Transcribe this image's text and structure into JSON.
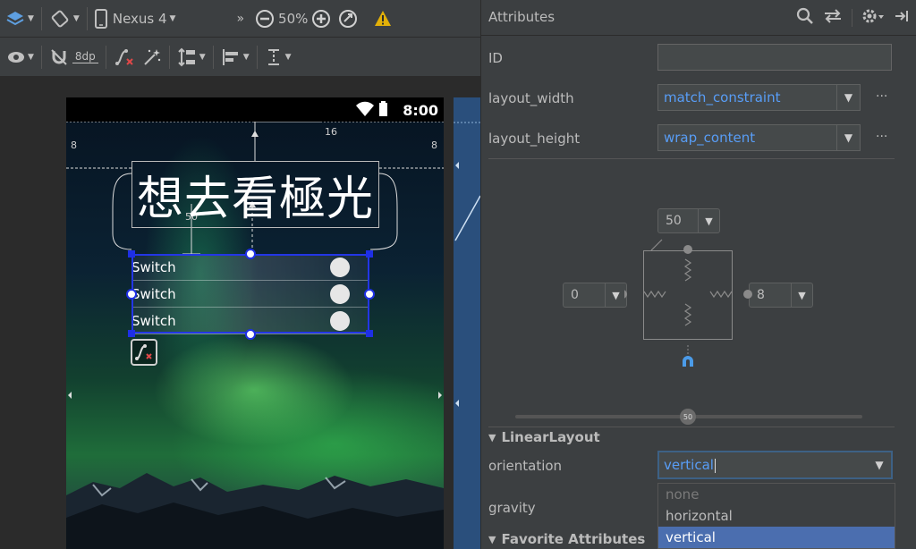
{
  "toolbar_top": {
    "device": "Nexus 4",
    "zoom": "50%",
    "more": "»",
    "icons": [
      "layers-icon",
      "rotate-icon",
      "phone-icon",
      "zoom-out-icon",
      "zoom-in-icon",
      "zoom-fit-icon",
      "warning-icon"
    ]
  },
  "toolbar_second": {
    "default_margin": "8dp",
    "icons": [
      "eye-icon",
      "magnet-off-icon",
      "clear-constraints-icon",
      "infer-constraints-icon",
      "pack-icon",
      "align-icon",
      "guideline-icon"
    ]
  },
  "phone": {
    "status_time": "8:00",
    "title": "想去看極光",
    "switches": [
      "Switch",
      "Switch",
      "Switch"
    ],
    "dimensions": {
      "top": "16",
      "left": "8",
      "right": "8",
      "gap": "50"
    }
  },
  "attributes": {
    "panel_title": "Attributes",
    "id_label": "ID",
    "id_value": "",
    "layout_width_label": "layout_width",
    "layout_width_value": "match_constraint",
    "layout_height_label": "layout_height",
    "layout_height_value": "wrap_content",
    "more_dots": "···",
    "constraint_widget": {
      "top": "50",
      "left": "0",
      "right": "8",
      "bias": "50"
    },
    "section_linear": "LinearLayout",
    "orientation_label": "orientation",
    "orientation_value": "vertical",
    "gravity_label": "gravity",
    "orientation_options": [
      "none",
      "horizontal",
      "vertical"
    ],
    "section_favorites": "Favorite Attributes"
  },
  "colors": {
    "accent": "#589df6",
    "selection": "#1e2fe6",
    "warning": "#e2b008",
    "dropdown_selected": "#4b6eaf"
  }
}
